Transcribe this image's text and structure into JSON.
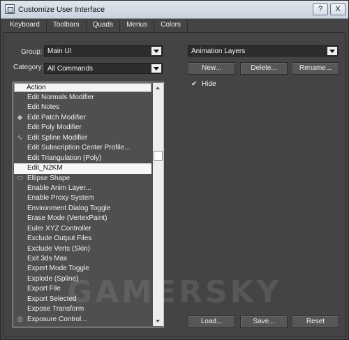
{
  "window": {
    "title": "Customize User Interface",
    "help_label": "?",
    "close_label": "X"
  },
  "tabs": [
    {
      "label": "Keyboard"
    },
    {
      "label": "Toolbars"
    },
    {
      "label": "Quads"
    },
    {
      "label": "Menus"
    },
    {
      "label": "Colors"
    }
  ],
  "group": {
    "label": "Group:",
    "value": "Main UI"
  },
  "category": {
    "label": "Category:",
    "value": "All Commands"
  },
  "layers": {
    "value": "Animation Layers"
  },
  "buttons": {
    "new": "New...",
    "delete": "Delete...",
    "rename": "Rename...",
    "load": "Load...",
    "save": "Save...",
    "reset": "Reset"
  },
  "hide": {
    "check": "✔",
    "label": "Hide"
  },
  "list": {
    "header": "Action",
    "rows": [
      {
        "label": "Edit Normals Modifier",
        "icon": ""
      },
      {
        "label": "Edit Notes",
        "icon": ""
      },
      {
        "label": "Edit Patch Modifier",
        "icon": "diamond-icon"
      },
      {
        "label": "Edit Poly Modifier",
        "icon": ""
      },
      {
        "label": "Edit Spline Modifier",
        "icon": "spline-icon"
      },
      {
        "label": "Edit Subscription Center Profile...",
        "icon": ""
      },
      {
        "label": "Edit Triangulation (Poly)",
        "icon": ""
      },
      {
        "label": "Edit_N2KM",
        "icon": "",
        "selected": true
      },
      {
        "label": "Ellipse Shape",
        "icon": "ellipse-icon"
      },
      {
        "label": "Enable Anim Layer...",
        "icon": ""
      },
      {
        "label": "Enable Proxy System",
        "icon": ""
      },
      {
        "label": "Environment Dialog Toggle",
        "icon": ""
      },
      {
        "label": "Erase Mode (VertexPaint)",
        "icon": ""
      },
      {
        "label": "Euler XYZ Controller",
        "icon": ""
      },
      {
        "label": "Exclude Output Files",
        "icon": ""
      },
      {
        "label": "Exclude Verts (Skin)",
        "icon": ""
      },
      {
        "label": "Exit 3ds Max",
        "icon": ""
      },
      {
        "label": "Expert Mode Toggle",
        "icon": ""
      },
      {
        "label": "Explode (Spline)",
        "icon": ""
      },
      {
        "label": "Export File",
        "icon": ""
      },
      {
        "label": "Export Selected",
        "icon": ""
      },
      {
        "label": "Expose Transform",
        "icon": ""
      },
      {
        "label": "Exposure Control...",
        "icon": "exposure-icon"
      }
    ]
  },
  "watermark": "GAMERSKY"
}
